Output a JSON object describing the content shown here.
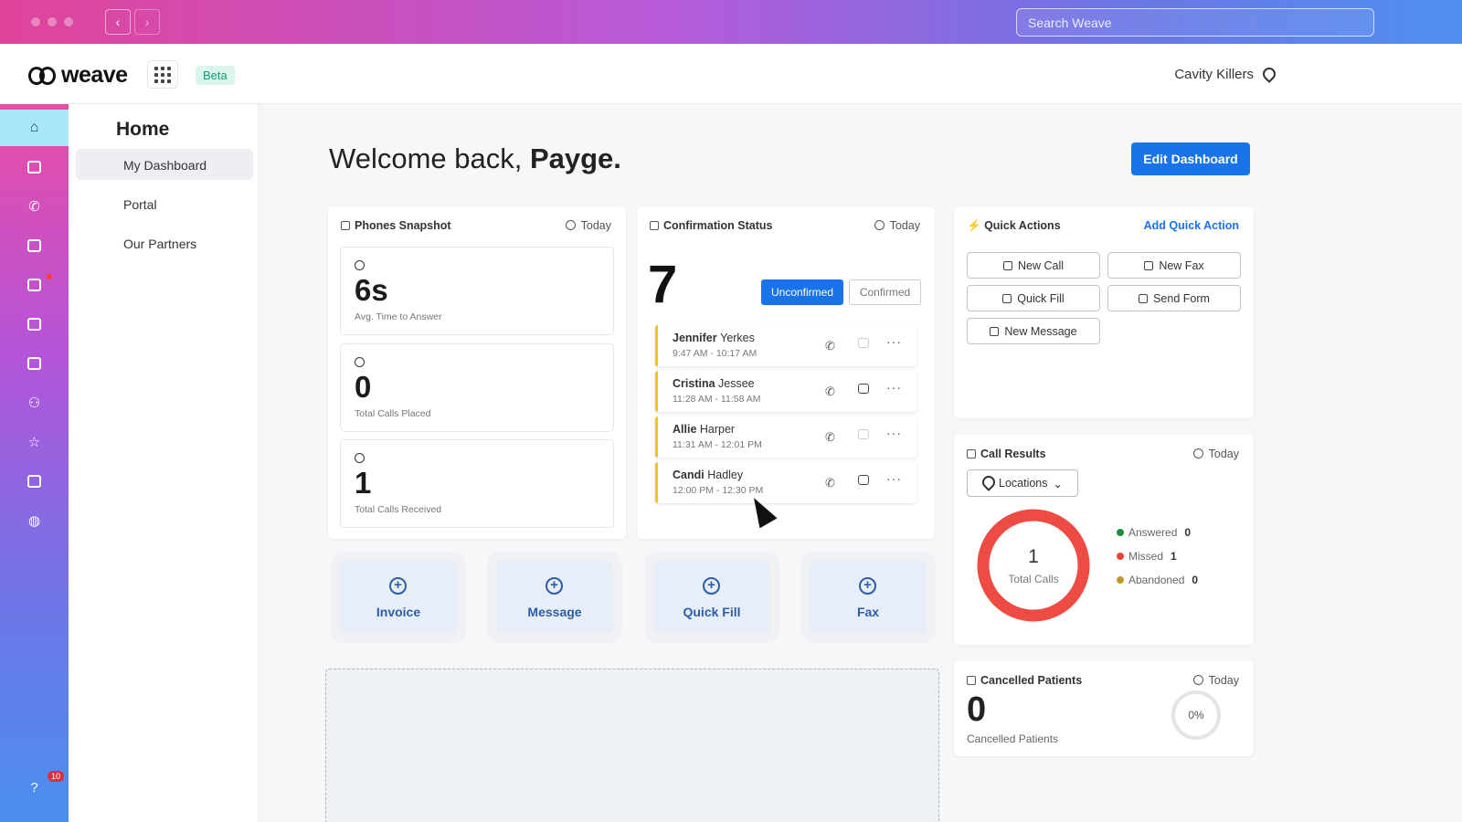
{
  "titlebar": {
    "search_placeholder": "Search Weave"
  },
  "header": {
    "logo_text": "weave",
    "beta_label": "Beta",
    "location": "Cavity Killers"
  },
  "rail": {
    "help_badge": "10"
  },
  "sidemenu": {
    "title": "Home",
    "items": [
      {
        "label": "My Dashboard"
      },
      {
        "label": "Portal"
      },
      {
        "label": "Our Partners"
      }
    ]
  },
  "main": {
    "welcome_prefix": "Welcome back, ",
    "welcome_name": "Payge.",
    "edit_button": "Edit Dashboard"
  },
  "phones": {
    "title": "Phones Snapshot",
    "period": "Today",
    "stats": [
      {
        "value": "6s",
        "label": "Avg. Time to Answer"
      },
      {
        "value": "0",
        "label": "Total Calls Placed"
      },
      {
        "value": "1",
        "label": "Total Calls Received"
      }
    ]
  },
  "confirmation": {
    "title": "Confirmation Status",
    "period": "Today",
    "count": "7",
    "tab_unconfirmed": "Unconfirmed",
    "tab_confirmed": "Confirmed",
    "appointments": [
      {
        "first": "Jennifer",
        "last": "Yerkes",
        "time": "9:47 AM - 10:17 AM"
      },
      {
        "first": "Cristina",
        "last": "Jessee",
        "time": "11:28 AM - 11:58 AM"
      },
      {
        "first": "Allie",
        "last": "Harper",
        "time": "11:31 AM - 12:01 PM"
      },
      {
        "first": "Candi",
        "last": "Hadley",
        "time": "12:00 PM - 12:30 PM"
      }
    ]
  },
  "quick_actions": {
    "title": "Quick Actions",
    "add_link": "Add Quick Action",
    "buttons": [
      "New Call",
      "New Fax",
      "Quick Fill",
      "Send Form",
      "New Message"
    ]
  },
  "tiles": [
    "Invoice",
    "Message",
    "Quick Fill",
    "Fax"
  ],
  "call_results": {
    "title": "Call Results",
    "period": "Today",
    "filter": "Locations",
    "total": "1",
    "total_label": "Total Calls",
    "legend": [
      {
        "label": "Answered",
        "value": "0",
        "color": "#1e8e3e"
      },
      {
        "label": "Missed",
        "value": "1",
        "color": "#ea4335"
      },
      {
        "label": "Abandoned",
        "value": "0",
        "color": "#c29a2a"
      }
    ],
    "ring_color": "#ee4b45"
  },
  "cancelled": {
    "title": "Cancelled Patients",
    "period": "Today",
    "count": "0",
    "label": "Cancelled Patients",
    "percent": "0%"
  }
}
